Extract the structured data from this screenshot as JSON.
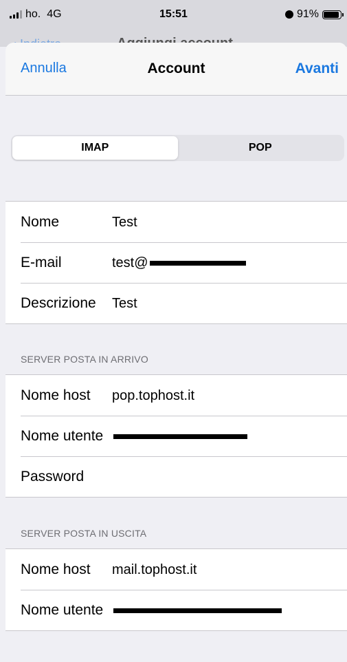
{
  "status_bar": {
    "carrier": "ho.",
    "network": "4G",
    "time": "15:51",
    "battery": "91%",
    "icons": [
      "signal-bars-icon",
      "alarm-icon",
      "battery-icon"
    ]
  },
  "background_nav": {
    "back_label": "Indietro",
    "title": "Aggiungi account"
  },
  "sheet_nav": {
    "cancel_label": "Annulla",
    "title": "Account",
    "next_label": "Avanti",
    "accent_color": "#1a78e0"
  },
  "segmented_control": {
    "options": [
      "IMAP",
      "POP"
    ],
    "selected": "IMAP"
  },
  "account_fields": [
    {
      "label": "Nome",
      "value": "Test"
    },
    {
      "label": "E-mail",
      "value": "test@"
    },
    {
      "label": "Descrizione",
      "value": "Test"
    }
  ],
  "incoming": {
    "header": "SERVER POSTA IN ARRIVO",
    "fields": [
      {
        "label": "Nome host",
        "value": "pop.tophost.it"
      },
      {
        "label": "Nome utente",
        "value": ""
      },
      {
        "label": "Password",
        "value": ""
      }
    ]
  },
  "outgoing": {
    "header": "SERVER POSTA IN USCITA",
    "fields": [
      {
        "label": "Nome host",
        "value": "mail.tophost.it"
      },
      {
        "label": "Nome utente",
        "value": ""
      }
    ]
  }
}
